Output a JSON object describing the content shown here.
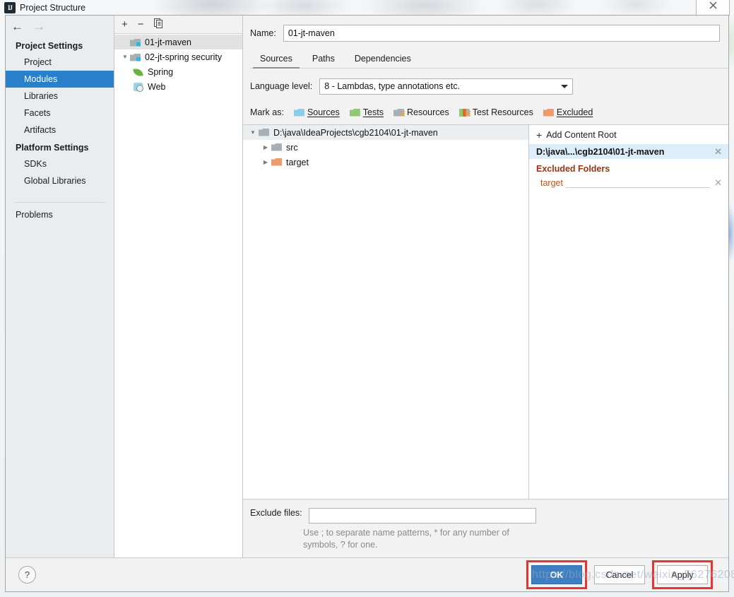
{
  "window": {
    "title": "Project Structure",
    "app_icon": "intellij-idea-icon",
    "close_label": "✕"
  },
  "sidebar": {
    "nav": {
      "back": "←",
      "forward": "→"
    },
    "groups": [
      {
        "title": "Project Settings",
        "items": [
          {
            "label": "Project",
            "selected": false
          },
          {
            "label": "Modules",
            "selected": true
          },
          {
            "label": "Libraries",
            "selected": false
          },
          {
            "label": "Facets",
            "selected": false
          },
          {
            "label": "Artifacts",
            "selected": false
          }
        ]
      },
      {
        "title": "Platform Settings",
        "items": [
          {
            "label": "SDKs",
            "selected": false
          },
          {
            "label": "Global Libraries",
            "selected": false
          }
        ]
      }
    ],
    "problems_label": "Problems"
  },
  "module_list": {
    "toolbar": {
      "add": "+",
      "remove": "−",
      "copy": "copy-icon"
    },
    "items": [
      {
        "label": "01-jt-maven",
        "icon": "module-folder-icon",
        "selected": true,
        "twisty": "",
        "indent": 0
      },
      {
        "label": "02-jt-spring security",
        "icon": "module-folder-icon",
        "selected": false,
        "twisty": "▼",
        "indent": 0
      },
      {
        "label": "Spring",
        "icon": "spring-leaf-icon",
        "selected": false,
        "twisty": "",
        "indent": 1
      },
      {
        "label": "Web",
        "icon": "web-facet-icon",
        "selected": false,
        "twisty": "",
        "indent": 1
      }
    ]
  },
  "content": {
    "name_label": "Name:",
    "name_value": "01-jt-maven",
    "tabs": [
      {
        "label": "Sources",
        "active": true
      },
      {
        "label": "Paths",
        "active": false
      },
      {
        "label": "Dependencies",
        "active": false
      }
    ],
    "language_level_label": "Language level:",
    "language_level_value": "8 - Lambdas, type annotations etc.",
    "mark_as_label": "Mark as:",
    "mark_as_options": [
      {
        "label": "Sources",
        "color": "#8ecdea",
        "kind": "plain"
      },
      {
        "label": "Tests",
        "color": "#8fca72",
        "kind": "plain"
      },
      {
        "label": "Resources",
        "color": "#a7b0b5",
        "kind": "resources"
      },
      {
        "label": "Test Resources",
        "color": "#8fca72",
        "kind": "testresources"
      },
      {
        "label": "Excluded",
        "color": "#ef9a6a",
        "kind": "plain"
      }
    ],
    "tree": [
      {
        "label": "D:\\java\\IdeaProjects\\cgb2104\\01-jt-maven",
        "twisty": "▼",
        "icon": "folder-gray-icon",
        "indent": 0,
        "root": true
      },
      {
        "label": "src",
        "twisty": "▶",
        "icon": "folder-gray-icon",
        "indent": 1,
        "root": false
      },
      {
        "label": "target",
        "twisty": "▶",
        "icon": "folder-orange-icon",
        "indent": 1,
        "root": false
      }
    ],
    "side_panel": {
      "add_content_root": "Add Content Root",
      "content_root": "D:\\java\\...\\cgb2104\\01-jt-maven",
      "excluded_header": "Excluded Folders",
      "excluded_items": [
        "target"
      ],
      "remove_glyph": "✕"
    },
    "exclude_files_label": "Exclude files:",
    "exclude_files_value": "",
    "exclude_files_hint": "Use ; to separate name patterns, * for any number of symbols, ? for one."
  },
  "footer": {
    "help_label": "?",
    "ok_label": "OK",
    "cancel_label": "Cancel",
    "apply_label": "Apply"
  },
  "watermark": "https://blog.csdn.net/weixin_56276208",
  "colors": {
    "selection_blue": "#2a7fca",
    "primary_button": "#3d7fc1",
    "highlight_red": "#e8332e",
    "excluded_orange": "#b4571f",
    "excluded_header": "#9a3412",
    "row_selected_gray": "#e2e2e2",
    "content_root_row": "#ddeefb"
  }
}
